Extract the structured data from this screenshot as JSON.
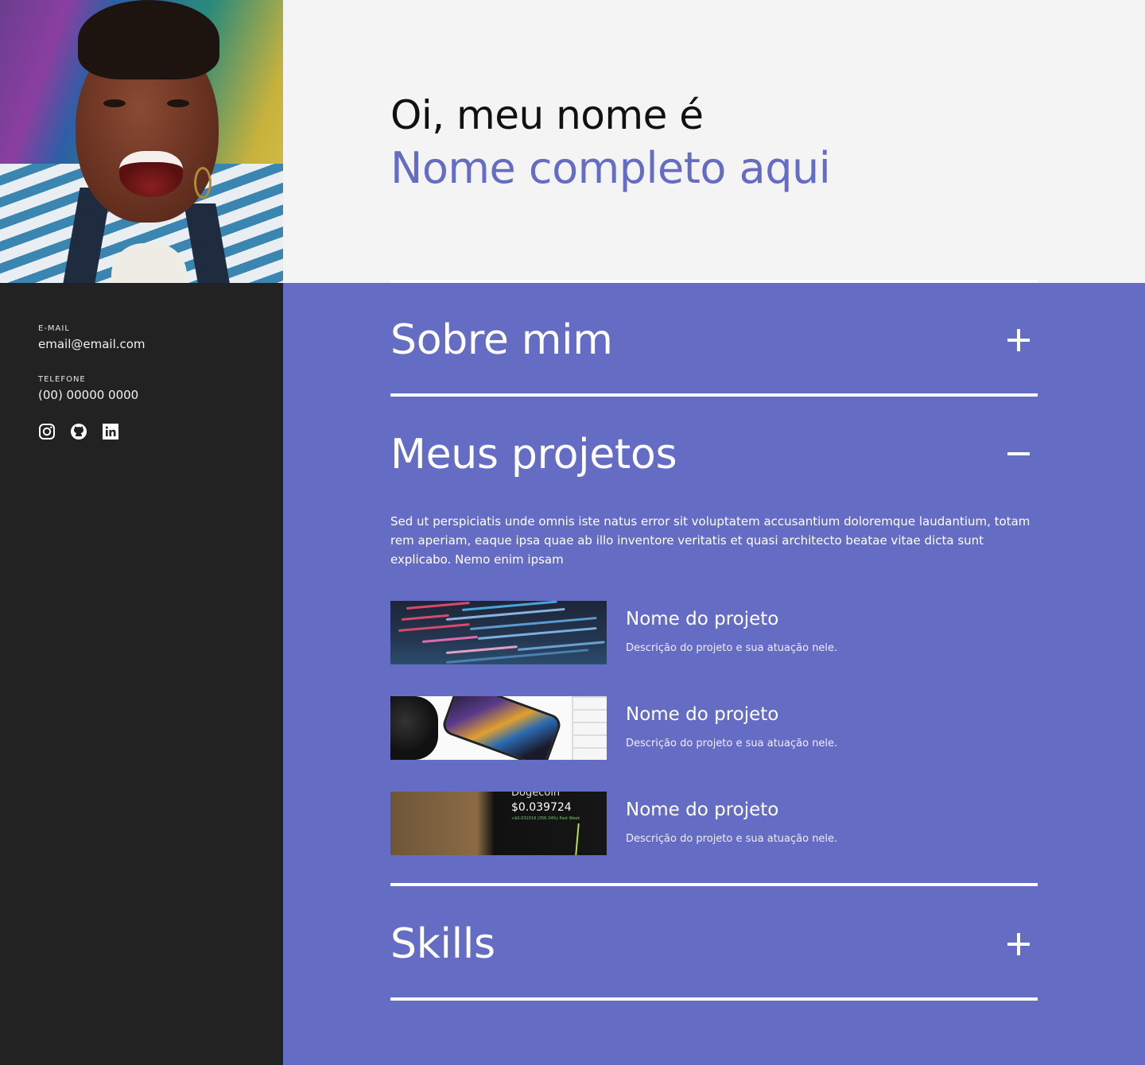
{
  "hero": {
    "greeting": "Oi, meu nome é",
    "full_name": "Nome completo aqui"
  },
  "contact": {
    "email_label": "E-MAIL",
    "email_value": "email@email.com",
    "phone_label": "TELEFONE",
    "phone_value": "(00) 00000 0000",
    "socials": [
      {
        "icon": "instagram-icon"
      },
      {
        "icon": "github-icon"
      },
      {
        "icon": "linkedin-icon"
      }
    ]
  },
  "accordion": {
    "sections": [
      {
        "title": "Sobre mim",
        "state": "collapsed",
        "toggle_symbol": "+"
      },
      {
        "title": "Meus projetos",
        "state": "expanded",
        "toggle_symbol": "−"
      },
      {
        "title": "Skills",
        "state": "collapsed",
        "toggle_symbol": "+"
      }
    ]
  },
  "projects": {
    "description": "Sed ut perspiciatis unde omnis iste natus error sit voluptatem accusantium doloremque laudantium, totam rem aperiam, eaque ipsa quae ab illo inventore veritatis et quasi architecto beatae vitae dicta sunt explicabo. Nemo enim ipsam",
    "items": [
      {
        "name": "Nome do projeto",
        "description": "Descrição do projeto e sua atuação nele."
      },
      {
        "name": "Nome do projeto",
        "description": "Descrição do projeto e sua atuação nele."
      },
      {
        "name": "Nome do projeto",
        "description": "Descrição do projeto e sua atuação nele.",
        "thumb_text": {
          "coin": "Dogecoin",
          "price": "$0.039724",
          "change": "+$0.031019 (356.34%) Past Week"
        }
      }
    ]
  },
  "colors": {
    "accent": "#646cc3",
    "dark": "#222222",
    "light": "#f4f4f4"
  }
}
